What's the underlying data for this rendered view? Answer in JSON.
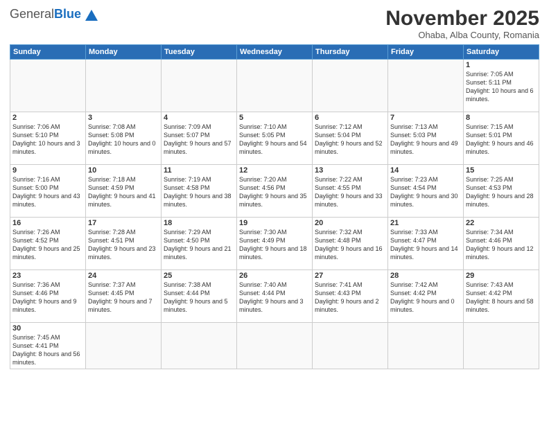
{
  "logo": {
    "general": "General",
    "blue": "Blue"
  },
  "title": "November 2025",
  "location": "Ohaba, Alba County, Romania",
  "days_of_week": [
    "Sunday",
    "Monday",
    "Tuesday",
    "Wednesday",
    "Thursday",
    "Friday",
    "Saturday"
  ],
  "weeks": [
    [
      {
        "day": "",
        "info": ""
      },
      {
        "day": "",
        "info": ""
      },
      {
        "day": "",
        "info": ""
      },
      {
        "day": "",
        "info": ""
      },
      {
        "day": "",
        "info": ""
      },
      {
        "day": "",
        "info": ""
      },
      {
        "day": "1",
        "info": "Sunrise: 7:05 AM\nSunset: 5:11 PM\nDaylight: 10 hours and 6 minutes."
      }
    ],
    [
      {
        "day": "2",
        "info": "Sunrise: 7:06 AM\nSunset: 5:10 PM\nDaylight: 10 hours and 3 minutes."
      },
      {
        "day": "3",
        "info": "Sunrise: 7:08 AM\nSunset: 5:08 PM\nDaylight: 10 hours and 0 minutes."
      },
      {
        "day": "4",
        "info": "Sunrise: 7:09 AM\nSunset: 5:07 PM\nDaylight: 9 hours and 57 minutes."
      },
      {
        "day": "5",
        "info": "Sunrise: 7:10 AM\nSunset: 5:05 PM\nDaylight: 9 hours and 54 minutes."
      },
      {
        "day": "6",
        "info": "Sunrise: 7:12 AM\nSunset: 5:04 PM\nDaylight: 9 hours and 52 minutes."
      },
      {
        "day": "7",
        "info": "Sunrise: 7:13 AM\nSunset: 5:03 PM\nDaylight: 9 hours and 49 minutes."
      },
      {
        "day": "8",
        "info": "Sunrise: 7:15 AM\nSunset: 5:01 PM\nDaylight: 9 hours and 46 minutes."
      }
    ],
    [
      {
        "day": "9",
        "info": "Sunrise: 7:16 AM\nSunset: 5:00 PM\nDaylight: 9 hours and 43 minutes."
      },
      {
        "day": "10",
        "info": "Sunrise: 7:18 AM\nSunset: 4:59 PM\nDaylight: 9 hours and 41 minutes."
      },
      {
        "day": "11",
        "info": "Sunrise: 7:19 AM\nSunset: 4:58 PM\nDaylight: 9 hours and 38 minutes."
      },
      {
        "day": "12",
        "info": "Sunrise: 7:20 AM\nSunset: 4:56 PM\nDaylight: 9 hours and 35 minutes."
      },
      {
        "day": "13",
        "info": "Sunrise: 7:22 AM\nSunset: 4:55 PM\nDaylight: 9 hours and 33 minutes."
      },
      {
        "day": "14",
        "info": "Sunrise: 7:23 AM\nSunset: 4:54 PM\nDaylight: 9 hours and 30 minutes."
      },
      {
        "day": "15",
        "info": "Sunrise: 7:25 AM\nSunset: 4:53 PM\nDaylight: 9 hours and 28 minutes."
      }
    ],
    [
      {
        "day": "16",
        "info": "Sunrise: 7:26 AM\nSunset: 4:52 PM\nDaylight: 9 hours and 25 minutes."
      },
      {
        "day": "17",
        "info": "Sunrise: 7:28 AM\nSunset: 4:51 PM\nDaylight: 9 hours and 23 minutes."
      },
      {
        "day": "18",
        "info": "Sunrise: 7:29 AM\nSunset: 4:50 PM\nDaylight: 9 hours and 21 minutes."
      },
      {
        "day": "19",
        "info": "Sunrise: 7:30 AM\nSunset: 4:49 PM\nDaylight: 9 hours and 18 minutes."
      },
      {
        "day": "20",
        "info": "Sunrise: 7:32 AM\nSunset: 4:48 PM\nDaylight: 9 hours and 16 minutes."
      },
      {
        "day": "21",
        "info": "Sunrise: 7:33 AM\nSunset: 4:47 PM\nDaylight: 9 hours and 14 minutes."
      },
      {
        "day": "22",
        "info": "Sunrise: 7:34 AM\nSunset: 4:46 PM\nDaylight: 9 hours and 12 minutes."
      }
    ],
    [
      {
        "day": "23",
        "info": "Sunrise: 7:36 AM\nSunset: 4:46 PM\nDaylight: 9 hours and 9 minutes."
      },
      {
        "day": "24",
        "info": "Sunrise: 7:37 AM\nSunset: 4:45 PM\nDaylight: 9 hours and 7 minutes."
      },
      {
        "day": "25",
        "info": "Sunrise: 7:38 AM\nSunset: 4:44 PM\nDaylight: 9 hours and 5 minutes."
      },
      {
        "day": "26",
        "info": "Sunrise: 7:40 AM\nSunset: 4:44 PM\nDaylight: 9 hours and 3 minutes."
      },
      {
        "day": "27",
        "info": "Sunrise: 7:41 AM\nSunset: 4:43 PM\nDaylight: 9 hours and 2 minutes."
      },
      {
        "day": "28",
        "info": "Sunrise: 7:42 AM\nSunset: 4:42 PM\nDaylight: 9 hours and 0 minutes."
      },
      {
        "day": "29",
        "info": "Sunrise: 7:43 AM\nSunset: 4:42 PM\nDaylight: 8 hours and 58 minutes."
      }
    ],
    [
      {
        "day": "30",
        "info": "Sunrise: 7:45 AM\nSunset: 4:41 PM\nDaylight: 8 hours and 56 minutes."
      },
      {
        "day": "",
        "info": ""
      },
      {
        "day": "",
        "info": ""
      },
      {
        "day": "",
        "info": ""
      },
      {
        "day": "",
        "info": ""
      },
      {
        "day": "",
        "info": ""
      },
      {
        "day": "",
        "info": ""
      }
    ]
  ]
}
